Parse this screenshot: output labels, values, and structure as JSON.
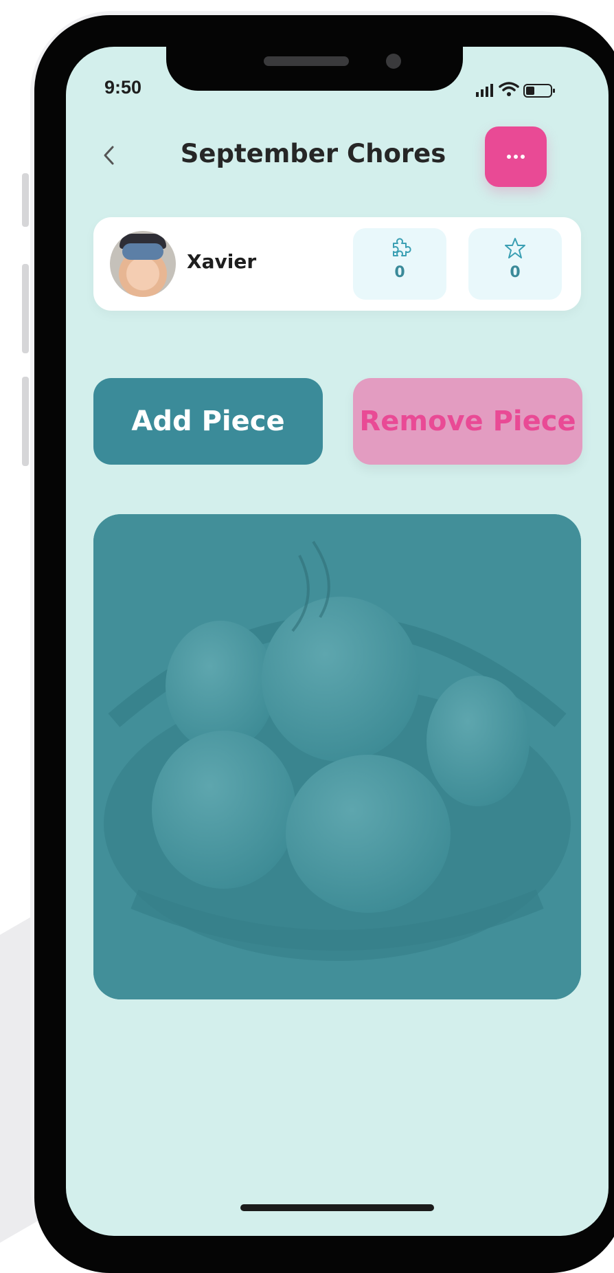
{
  "status_bar": {
    "time": "9:50"
  },
  "header": {
    "title": "September Chores"
  },
  "profile": {
    "name": "Xavier",
    "pieces_count": "0",
    "stars_count": "0"
  },
  "actions": {
    "add_label": "Add Piece",
    "remove_label": "Remove Piece"
  },
  "colors": {
    "background": "#d3efec",
    "accent_teal": "#3b8b99",
    "accent_pink": "#e94a95",
    "remove_button_bg": "#e39cc1"
  },
  "icons": {
    "back": "chevron-left-icon",
    "more": "ellipsis-icon",
    "pieces": "puzzle-icon",
    "stars": "star-icon"
  }
}
